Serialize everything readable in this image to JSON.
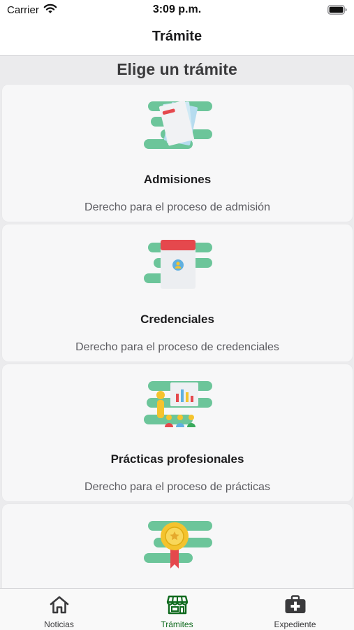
{
  "status_bar": {
    "carrier": "Carrier",
    "time": "3:09 p.m."
  },
  "nav": {
    "title": "Trámite"
  },
  "section": {
    "title": "Elige un trámite"
  },
  "cards": [
    {
      "title": "Admisiones",
      "description": "Derecho para el proceso de admisión",
      "icon": "documents-icon"
    },
    {
      "title": "Credenciales",
      "description": "Derecho para el proceso de credenciales",
      "icon": "id-card-icon"
    },
    {
      "title": "Prácticas profesionales",
      "description": "Derecho para el proceso de prácticas",
      "icon": "presentation-icon"
    },
    {
      "title": "",
      "description": "",
      "icon": "award-ribbon-icon"
    }
  ],
  "tabs": [
    {
      "label": "Noticias",
      "icon": "home-icon",
      "active": false
    },
    {
      "label": "Trámites",
      "icon": "store-icon",
      "active": true
    },
    {
      "label": "Expediente",
      "icon": "medical-briefcase-icon",
      "active": false
    }
  ],
  "colors": {
    "accent": "#0f6a1e",
    "icon_cloud": "#6cc59a",
    "card_background": "#f7f7f8",
    "content_background": "#ebebed"
  }
}
